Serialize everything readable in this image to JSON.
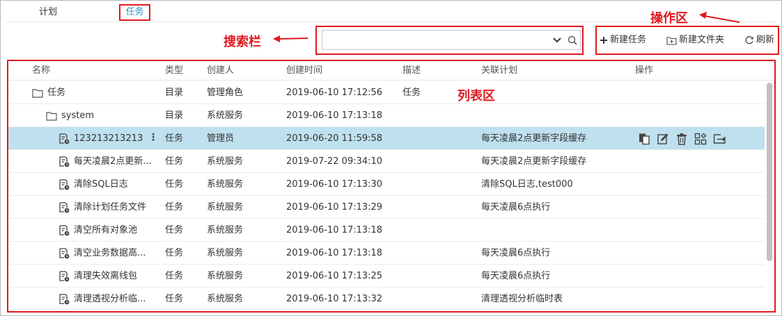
{
  "tabs": [
    {
      "label": "计划"
    },
    {
      "label": "任务"
    }
  ],
  "annotations": {
    "ops_area": "操作区",
    "search_bar": "搜索栏",
    "list_area": "列表区"
  },
  "search": {
    "placeholder": "",
    "value": ""
  },
  "toolbar": {
    "new_task": "新建任务",
    "new_folder": "新建文件夹",
    "refresh": "刷新"
  },
  "columns": {
    "name": "名称",
    "type": "类型",
    "creator": "创建人",
    "created_time": "创建时间",
    "description": "描述",
    "related_plan": "关联计划",
    "actions": "操作"
  },
  "rows": [
    {
      "name": "任务",
      "type": "目录",
      "creator": "管理角色",
      "created_time": "2019-06-10 17:12:56",
      "description": "任务",
      "related_plan": "",
      "kind": "folder",
      "indent": 0
    },
    {
      "name": "system",
      "type": "目录",
      "creator": "系统服务",
      "created_time": "2019-06-10 17:13:18",
      "description": "",
      "related_plan": "",
      "kind": "folder",
      "indent": 1
    },
    {
      "name": "123213213213",
      "type": "任务",
      "creator": "管理员",
      "created_time": "2019-06-20 11:59:58",
      "description": "",
      "related_plan": "每天凌晨2点更新字段缓存",
      "kind": "task",
      "indent": 2,
      "selected": true
    },
    {
      "name": "每天凌晨2点更新...",
      "type": "任务",
      "creator": "系统服务",
      "created_time": "2019-07-22 09:34:10",
      "description": "",
      "related_plan": "每天凌晨2点更新字段缓存",
      "kind": "task",
      "indent": 2
    },
    {
      "name": "清除SQL日志",
      "type": "任务",
      "creator": "系统服务",
      "created_time": "2019-06-10 17:13:30",
      "description": "",
      "related_plan": "清除SQL日志,test000",
      "kind": "task",
      "indent": 2
    },
    {
      "name": "清除计划任务文件",
      "type": "任务",
      "creator": "系统服务",
      "created_time": "2019-06-10 17:13:29",
      "description": "",
      "related_plan": "每天凌晨6点执行",
      "kind": "task",
      "indent": 2
    },
    {
      "name": "清空所有对象池",
      "type": "任务",
      "creator": "系统服务",
      "created_time": "2019-06-10 17:13:18",
      "description": "",
      "related_plan": "",
      "kind": "task",
      "indent": 2
    },
    {
      "name": "清空业务数据高...",
      "type": "任务",
      "creator": "系统服务",
      "created_time": "2019-06-10 17:13:18",
      "description": "",
      "related_plan": "每天凌晨6点执行",
      "kind": "task",
      "indent": 2
    },
    {
      "name": "清理失效离线包",
      "type": "任务",
      "creator": "系统服务",
      "created_time": "2019-06-10 17:13:25",
      "description": "",
      "related_plan": "每天凌晨6点执行",
      "kind": "task",
      "indent": 2
    },
    {
      "name": "清理透视分析临...",
      "type": "任务",
      "creator": "系统服务",
      "created_time": "2019-06-10 17:13:32",
      "description": "",
      "related_plan": "清理透视分析临时表",
      "kind": "task",
      "indent": 2
    }
  ],
  "row_action_icons": [
    "copy-icon",
    "edit-icon",
    "delete-icon",
    "manage-icon",
    "move-icon"
  ],
  "colors": {
    "accent": "#2b8fc9",
    "annotation": "#e0191e",
    "selected_row": "#bfe0ee"
  }
}
